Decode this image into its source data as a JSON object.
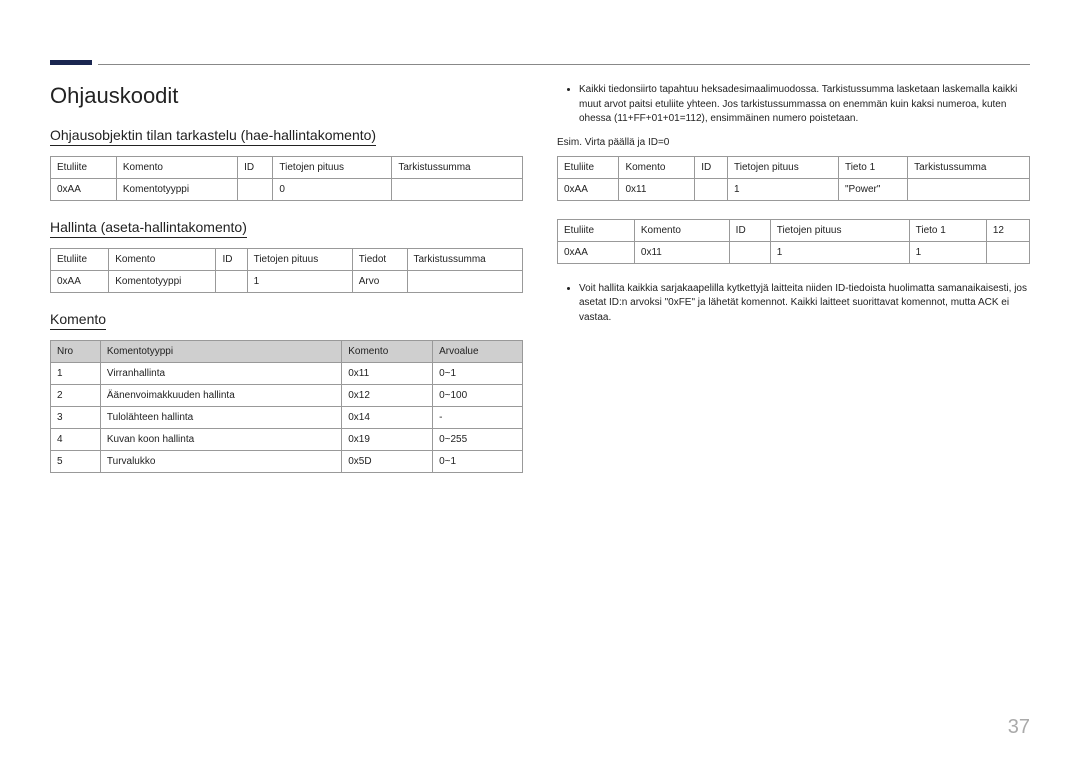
{
  "h1": "Ohjauskoodit",
  "h2_1": "Ohjausobjektin tilan tarkastelu (hae-hallintakomento)",
  "h2_2": "Hallinta (aseta-hallintakomento)",
  "h2_3": "Komento",
  "table1": {
    "headers": [
      "Etuliite",
      "Komento",
      "ID",
      "Tietojen pituus",
      "Tarkistussumma"
    ],
    "row": [
      "0xAA",
      "Komentotyyppi",
      "",
      "0",
      ""
    ]
  },
  "table2": {
    "headers": [
      "Etuliite",
      "Komento",
      "ID",
      "Tietojen pituus",
      "Tiedot",
      "Tarkistussumma"
    ],
    "row": [
      "0xAA",
      "Komentotyyppi",
      "",
      "1",
      "Arvo",
      ""
    ]
  },
  "table3": {
    "headers": [
      "Nro",
      "Komentotyyppi",
      "Komento",
      "Arvoalue"
    ],
    "rows": [
      [
        "1",
        "Virranhallinta",
        "0x11",
        "0~1"
      ],
      [
        "2",
        "Äänenvoimakkuuden hallinta",
        "0x12",
        "0~100"
      ],
      [
        "3",
        "Tulolähteen hallinta",
        "0x14",
        "-"
      ],
      [
        "4",
        "Kuvan koon hallinta",
        "0x19",
        "0~255"
      ],
      [
        "5",
        "Turvalukko",
        "0x5D",
        "0~1"
      ]
    ]
  },
  "bullet1": "Kaikki tiedonsiirto tapahtuu heksadesimaalimuodossa. Tarkistussumma lasketaan laskemalla kaikki muut arvot paitsi etuliite yhteen. Jos tarkistussummassa on enemmän kuin kaksi numeroa, kuten ohessa (11+FF+01+01=112), ensimmäinen numero poistetaan.",
  "example": "Esim. Virta päällä ja ID=0",
  "table4": {
    "headers": [
      "Etuliite",
      "Komento",
      "ID",
      "Tietojen pituus",
      "Tieto 1",
      "Tarkistussumma"
    ],
    "row": [
      "0xAA",
      "0x11",
      "",
      "1",
      "\"Power\"",
      ""
    ]
  },
  "table5": {
    "headers": [
      "Etuliite",
      "Komento",
      "ID",
      "Tietojen pituus",
      "Tieto 1",
      "12"
    ],
    "row": [
      "0xAA",
      "0x11",
      "",
      "1",
      "1",
      ""
    ]
  },
  "bullet2": "Voit hallita kaikkia sarjakaapelilla kytkettyjä laitteita niiden ID-tiedoista huolimatta samanaikaisesti, jos asetat ID:n arvoksi \"0xFE\" ja lähetät komennot. Kaikki laitteet suorittavat komennot, mutta ACK ei vastaa.",
  "page_number": "37"
}
